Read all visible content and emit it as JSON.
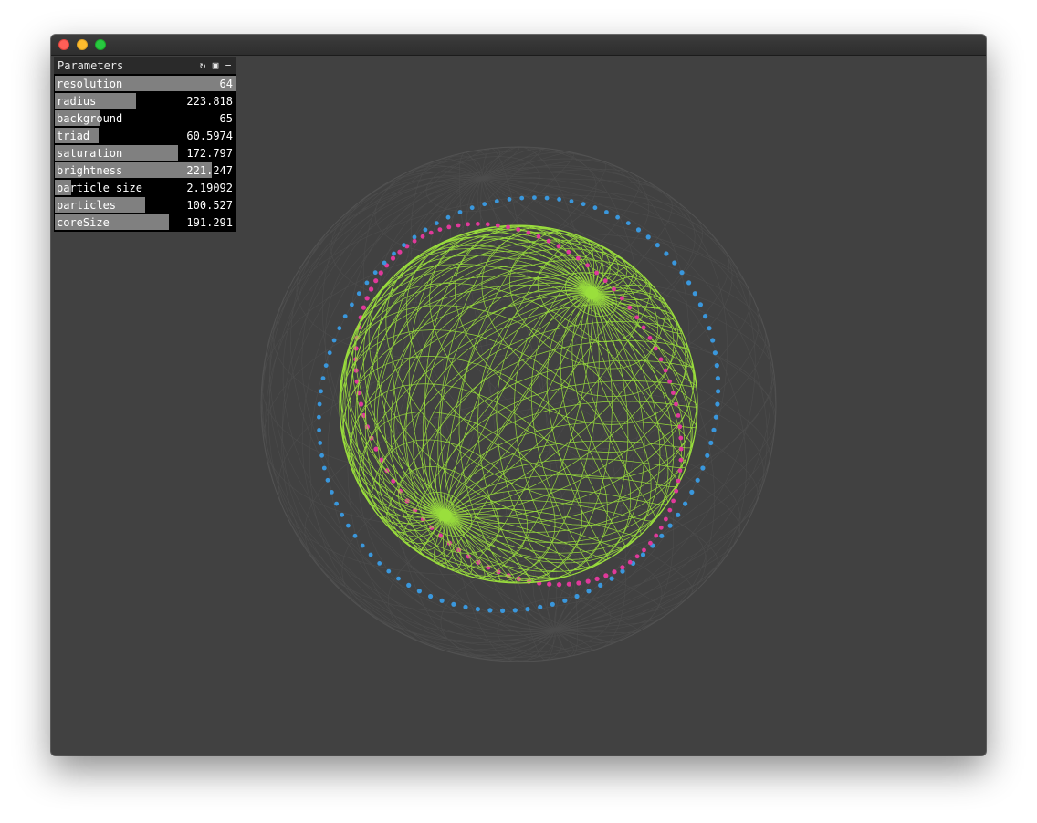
{
  "window": {
    "controls": [
      "close",
      "minimize",
      "zoom"
    ]
  },
  "panel": {
    "title": "Parameters",
    "icons": [
      "refresh-icon",
      "save-icon",
      "minimize-icon"
    ],
    "params": [
      {
        "label": "resolution",
        "value": "64",
        "fill": 1.0
      },
      {
        "label": "radius",
        "value": "223.818",
        "fill": 0.45
      },
      {
        "label": "background",
        "value": "65",
        "fill": 0.255
      },
      {
        "label": "triad",
        "value": "60.5974",
        "fill": 0.24
      },
      {
        "label": "saturation",
        "value": "172.797",
        "fill": 0.68
      },
      {
        "label": "brightness",
        "value": "221.247",
        "fill": 0.87
      },
      {
        "label": "particle size",
        "value": "2.19092",
        "fill": 0.09
      },
      {
        "label": "particles",
        "value": "100.527",
        "fill": 0.5
      },
      {
        "label": "coreSize",
        "value": "191.291",
        "fill": 0.63
      }
    ]
  },
  "scene": {
    "background": "#414141",
    "outer_sphere_color": "#565656",
    "core_sphere_color": "#9be03c",
    "particle_ring_colors": [
      "#e0399a",
      "#3a97dc"
    ]
  }
}
